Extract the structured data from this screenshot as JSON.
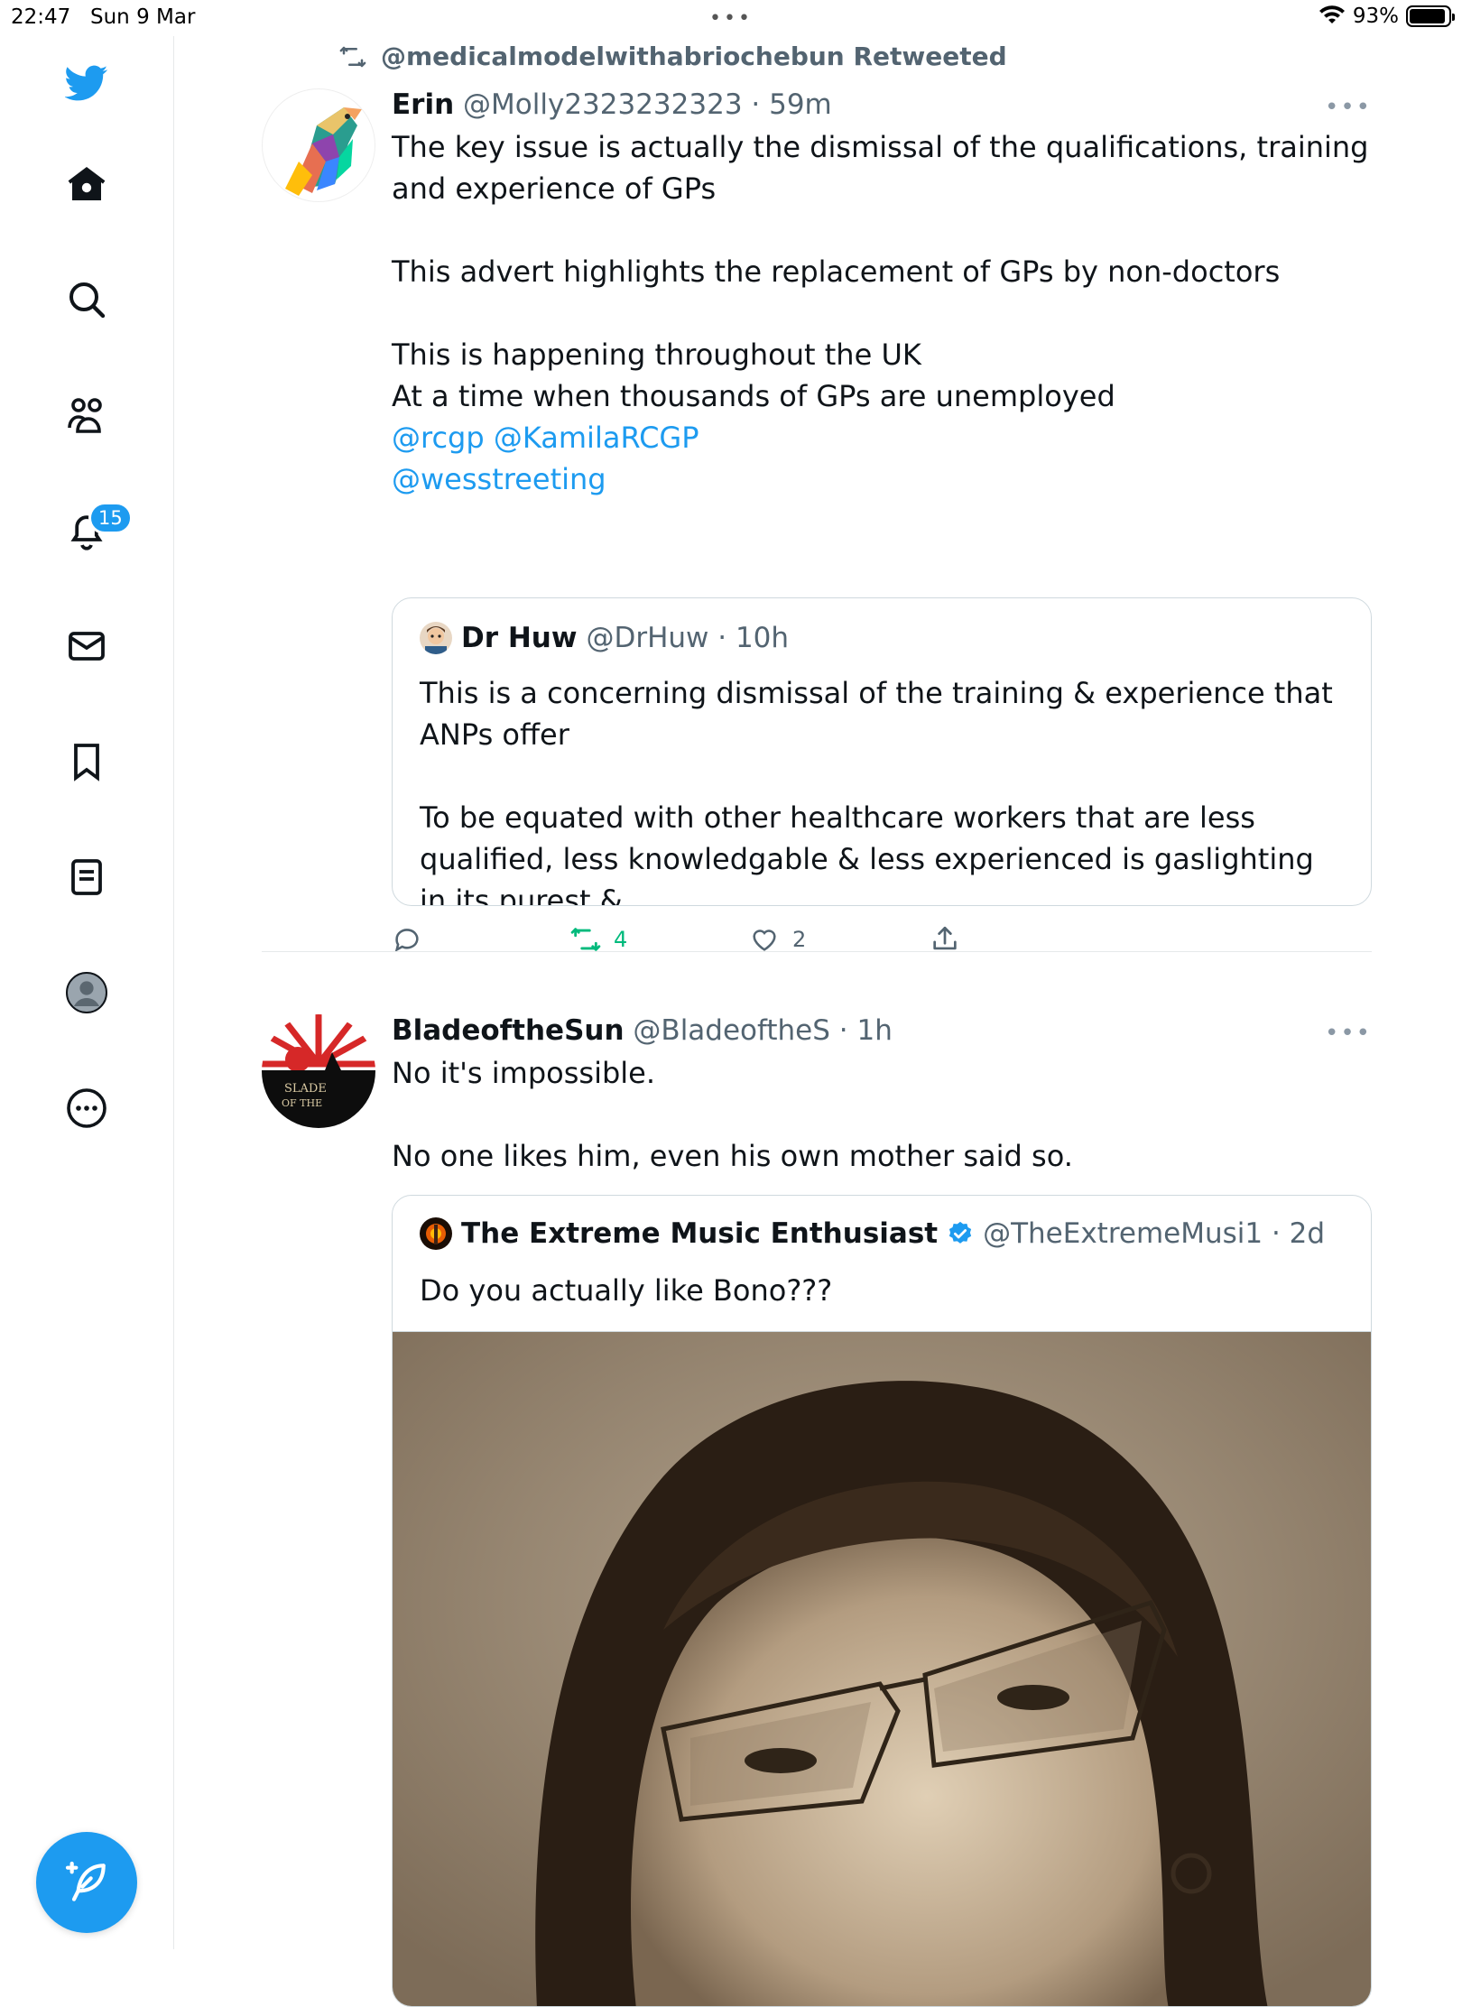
{
  "status_bar": {
    "time": "22:47",
    "date": "Sun 9 Mar",
    "dots": "•••",
    "battery": "93%",
    "battery_level": 0.93
  },
  "sidebar": {
    "items": [
      {
        "name": "twitter-logo-icon"
      },
      {
        "name": "home-icon"
      },
      {
        "name": "search-icon"
      },
      {
        "name": "communities-icon"
      },
      {
        "name": "notifications-icon"
      },
      {
        "name": "messages-icon"
      },
      {
        "name": "bookmarks-icon"
      },
      {
        "name": "lists-icon"
      },
      {
        "name": "profile-icon"
      },
      {
        "name": "more-icon"
      }
    ],
    "notifications_badge": "15",
    "accent": "#1d9bf0"
  },
  "tweets": [
    {
      "retweeted_by": "@medicalmodelwithabriochebun Retweeted",
      "name": "Erin",
      "meta": "@Molly2323232323 · 59m",
      "more": "•••",
      "text": "The key issue is actually the dismissal of the qualifications, training and experience of GPs\n\nThis advert highlights the replacement of GPs by non-doctors\n\nThis is happening throughout the UK\nAt a time when thousands of GPs are unemployed",
      "mentions_line1": "@rcgp @KamilaRCGP",
      "mentions_line2": "@wesstreeting",
      "quote": {
        "name": "Dr Huw",
        "meta": "@DrHuw · 10h",
        "text": "This is a concerning dismissal of the training & experience that ANPs offer\n\nTo be equated with other healthcare workers that are less qualified, less knowledgable & less experienced is gaslighting in its purest &..."
      },
      "actions": {
        "reply_count": "",
        "retweet_count": "4",
        "like_count": "2",
        "retweet_active_color": "#00ba7c"
      }
    },
    {
      "name": "BladeoftheSun",
      "meta": "@BladeoftheS · 1h",
      "more": "•••",
      "avatar_text": "BLADE OF THE",
      "text": "No it's impossible.\n\nNo one likes him, even his own mother said so.",
      "quote": {
        "name": "The Extreme Music Enthusiast",
        "meta": "@TheExtremeMusi1 · 2d",
        "verified": true,
        "text": "Do you actually like Bono???",
        "image": "sepia-portrait-photo"
      }
    }
  ]
}
